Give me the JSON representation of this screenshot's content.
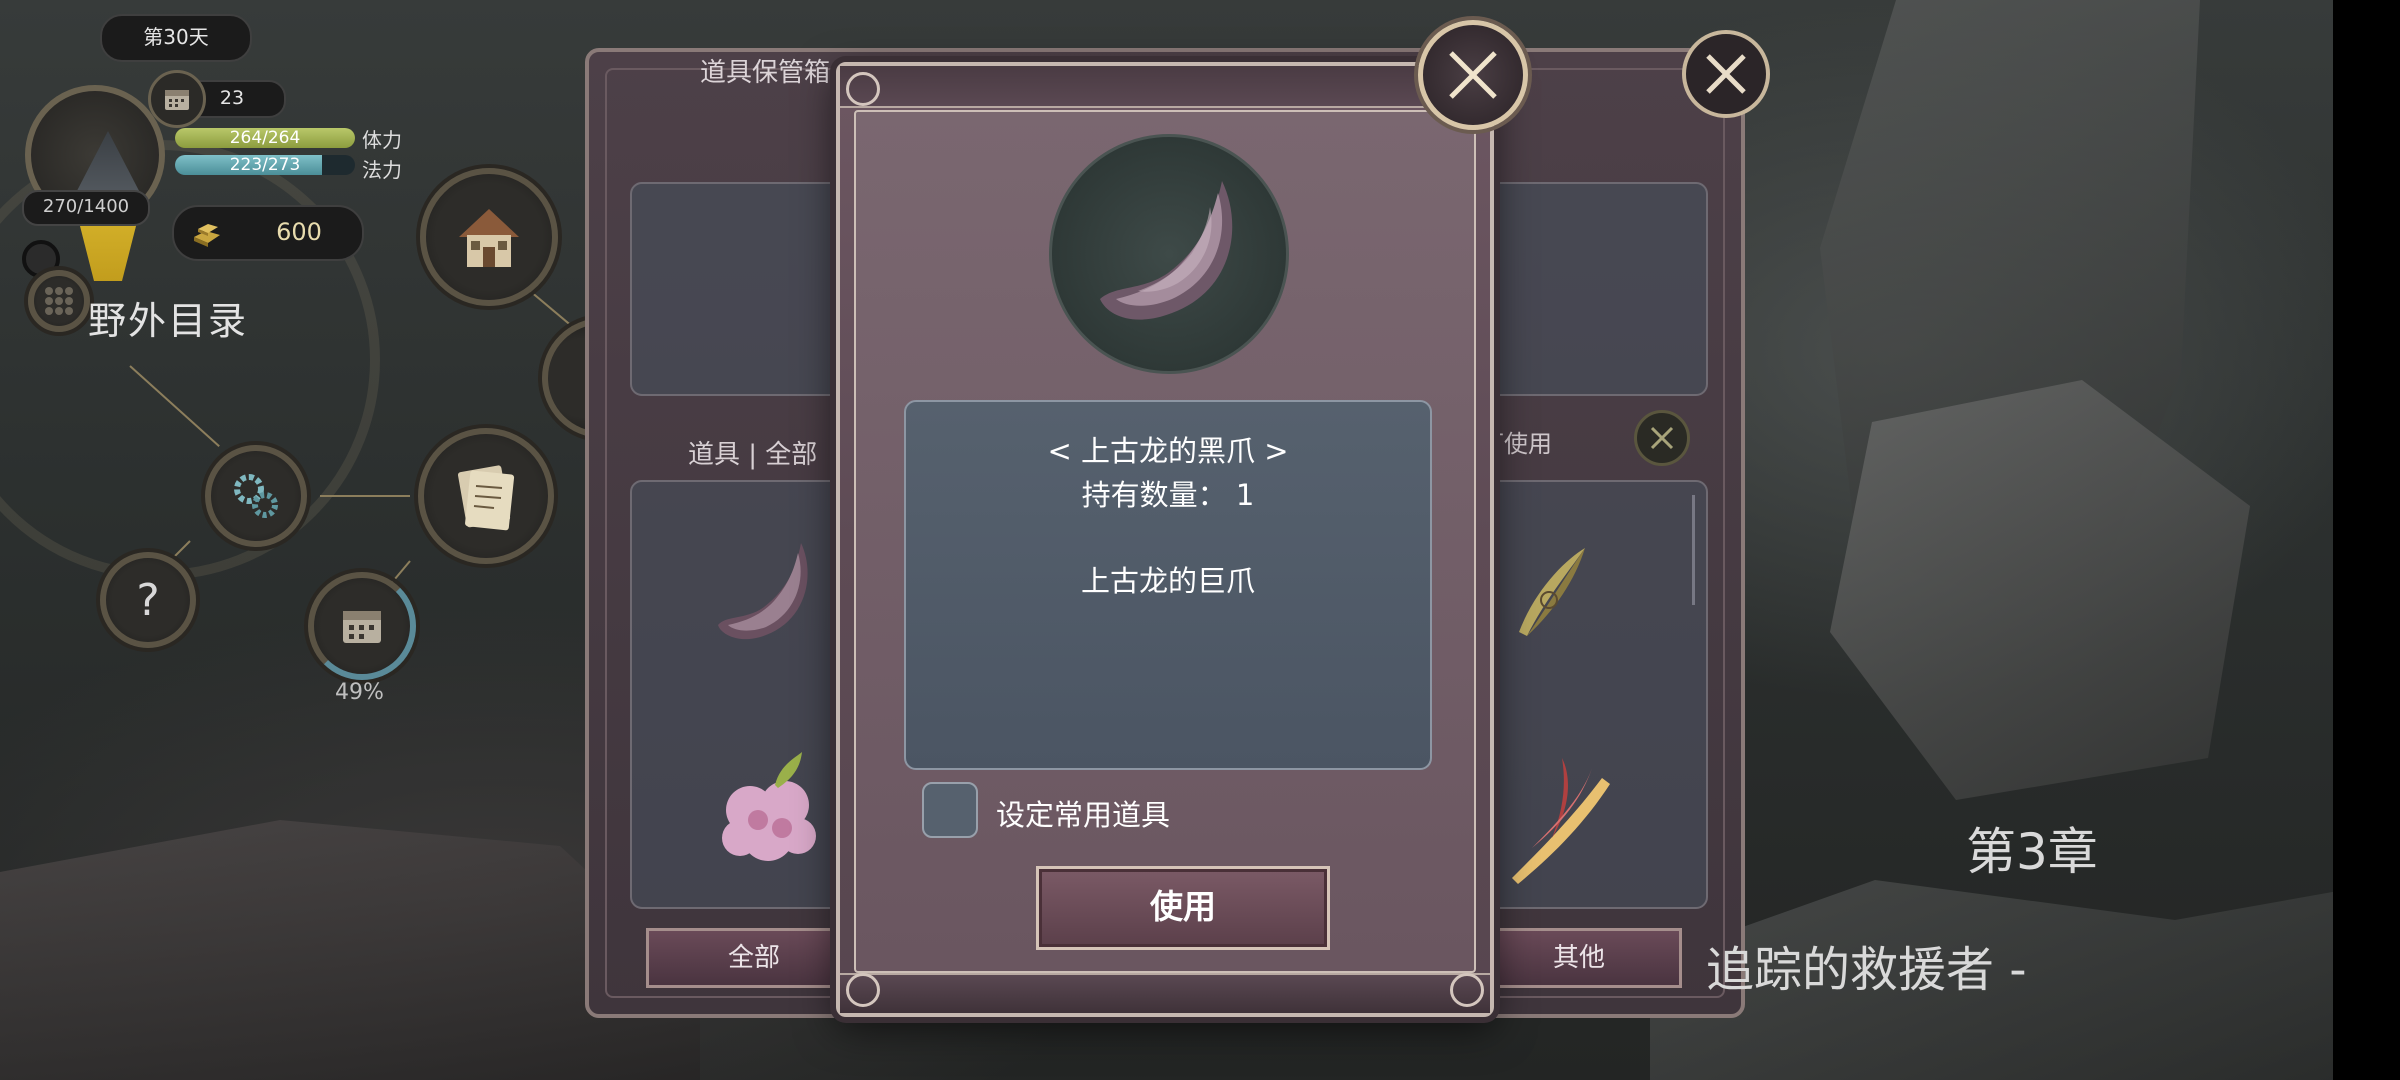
{
  "hud": {
    "day": "第30天",
    "days_count": "23",
    "hp_text": "264/264",
    "hp_fraction": 1.0,
    "hp_label": "体力",
    "mp_text": "223/273",
    "mp_fraction": 0.817,
    "mp_label": "法力",
    "xp": "270/1400",
    "gold": "600",
    "field_menu": "野外目录",
    "progress_percent": "49%"
  },
  "back_panel": {
    "title": "道具保管箱",
    "category": "道具 | 全部",
    "hint": "具即可使用",
    "tab_all": "全部",
    "tab_other": "其他"
  },
  "modal": {
    "item_name": "< 上古龙的黑爪 >",
    "count_text": "持有数量： 1",
    "description": "上古龙的巨爪",
    "favorite_label": "设定常用道具",
    "use_button": "使用"
  },
  "chapter": {
    "title": "第3章",
    "subtitle": "追踪的救援者 -"
  },
  "icons": {
    "close": "close-icon",
    "claw": "dragon-claw-icon",
    "calendar": "calendar-icon",
    "gold": "gold-icon",
    "house": "house-icon",
    "gears": "gears-icon",
    "scroll": "scroll-icon",
    "help": "question-icon"
  },
  "colors": {
    "hp": "#a8b85a",
    "mp": "#6aaab4",
    "panel": "#5e4b55",
    "desc_box": "#4f5967"
  }
}
